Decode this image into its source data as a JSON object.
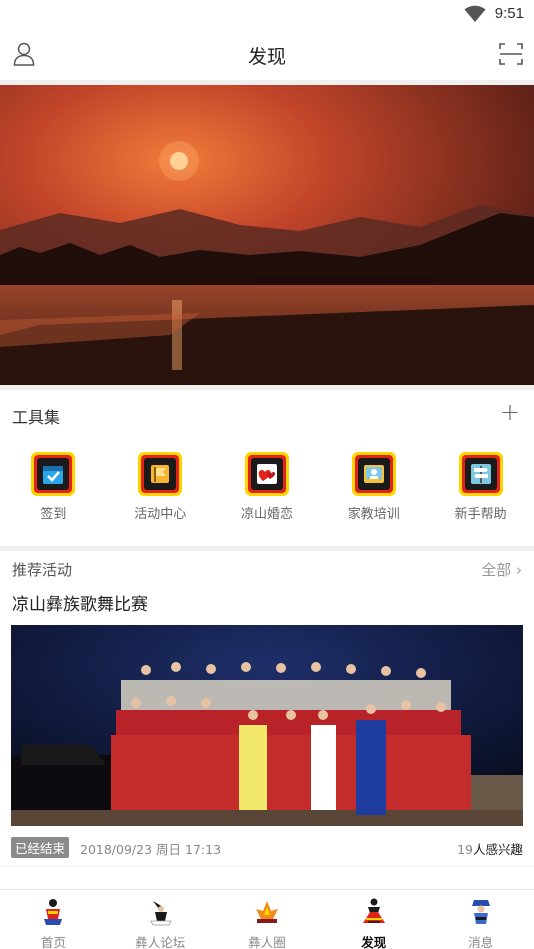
{
  "status_bar": {
    "time": "9:51",
    "wifi_icon": "wifi-icon"
  },
  "header": {
    "title": "发现",
    "left_icon": "user-icon",
    "right_icon": "scan-icon"
  },
  "banner": {
    "image": "sunset-lake-banner",
    "colors": {
      "sky": "#c2452a",
      "sun": "#ffd08a",
      "water": "#8a3a25"
    }
  },
  "tools": {
    "label": "工具集",
    "add_label": "+",
    "items": [
      {
        "label": "签到",
        "icon": "checkin-calendar-icon"
      },
      {
        "label": "活动中心",
        "icon": "activity-flag-icon"
      },
      {
        "label": "凉山婚恋",
        "icon": "hearts-icon"
      },
      {
        "label": "家教培训",
        "icon": "tutoring-board-icon"
      },
      {
        "label": "新手帮助",
        "icon": "signpost-icon"
      }
    ],
    "colors": {
      "outer": "#ffd400",
      "ring": "#e2231a",
      "core": "#1a1a1a"
    }
  },
  "recommended": {
    "label": "推荐活动",
    "more_label": "全部",
    "event": {
      "title": "凉山彝族歌舞比赛",
      "image": "choir-stage-photo",
      "status": "已经结束",
      "datetime": "2018/09/23 周日 17:13",
      "interest_count": "19",
      "interest_suffix": "人感兴趣"
    }
  },
  "tabbar": {
    "active": "发现",
    "items": [
      {
        "label": "首页",
        "icon": "home-figure-icon"
      },
      {
        "label": "彝人论坛",
        "icon": "forum-figure-icon"
      },
      {
        "label": "彝人圈",
        "icon": "circle-fire-icon"
      },
      {
        "label": "发现",
        "icon": "discover-dancer-icon"
      },
      {
        "label": "消息",
        "icon": "message-figure-icon"
      }
    ]
  }
}
